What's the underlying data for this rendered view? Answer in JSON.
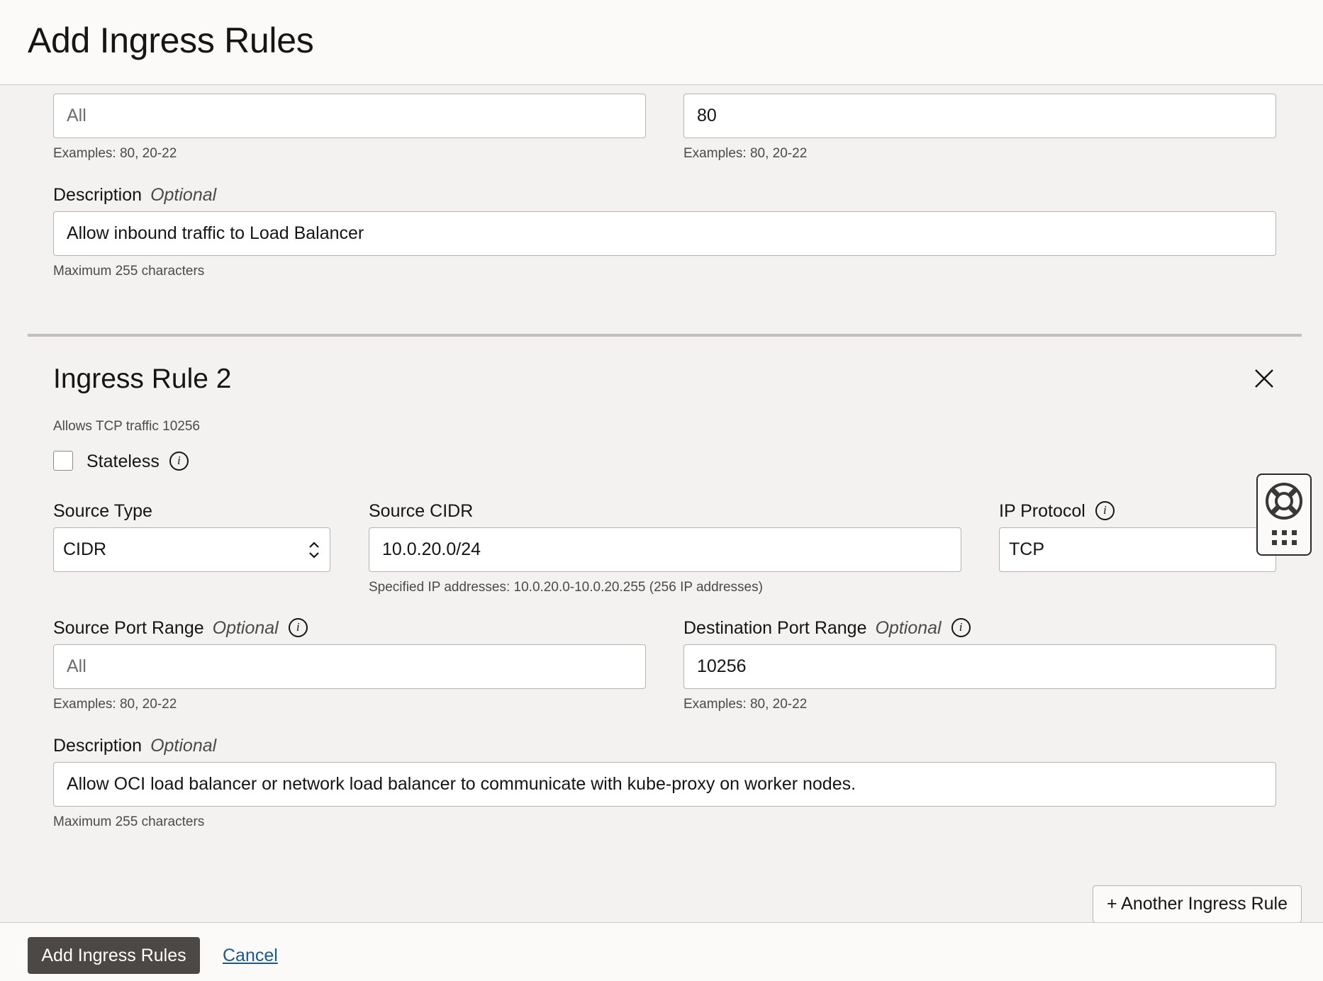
{
  "header": {
    "title": "Add Ingress Rules"
  },
  "rule1": {
    "source_port_range": {
      "placeholder": "All",
      "hint": "Examples: 80, 20-22"
    },
    "destination_port_range": {
      "value": "80",
      "hint": "Examples: 80, 20-22"
    },
    "description": {
      "label": "Description",
      "optional": "Optional",
      "value": "Allow inbound traffic to Load Balancer",
      "hint": "Maximum 255 characters"
    }
  },
  "rule2": {
    "title": "Ingress Rule 2",
    "summary": "Allows TCP traffic 10256",
    "stateless_label": "Stateless",
    "stateless_checked": false,
    "source_type": {
      "label": "Source Type",
      "value": "CIDR"
    },
    "source_cidr": {
      "label": "Source CIDR",
      "value": "10.0.20.0/24",
      "hint": "Specified IP addresses: 10.0.20.0-10.0.20.255 (256 IP addresses)"
    },
    "ip_protocol": {
      "label": "IP Protocol",
      "value": "TCP"
    },
    "source_port_range": {
      "label": "Source Port Range",
      "optional": "Optional",
      "placeholder": "All",
      "hint": "Examples: 80, 20-22"
    },
    "destination_port_range": {
      "label": "Destination Port Range",
      "optional": "Optional",
      "value": "10256",
      "hint": "Examples: 80, 20-22"
    },
    "description": {
      "label": "Description",
      "optional": "Optional",
      "value": "Allow OCI load balancer or network load balancer to communicate with kube-proxy on worker nodes.",
      "hint": "Maximum 255 characters"
    }
  },
  "another_rule_button": "+ Another Ingress Rule",
  "footer": {
    "submit_label": "Add Ingress Rules",
    "cancel_label": "Cancel"
  },
  "icons": {
    "info": "info-icon",
    "close": "close-icon",
    "help": "lifebuoy-icon",
    "apps": "grid-icon",
    "select": "updown-chevron-icon"
  },
  "colors": {
    "primary_button": "#4b4845",
    "link": "#1a5a8c",
    "background": "#f3f2f1"
  }
}
